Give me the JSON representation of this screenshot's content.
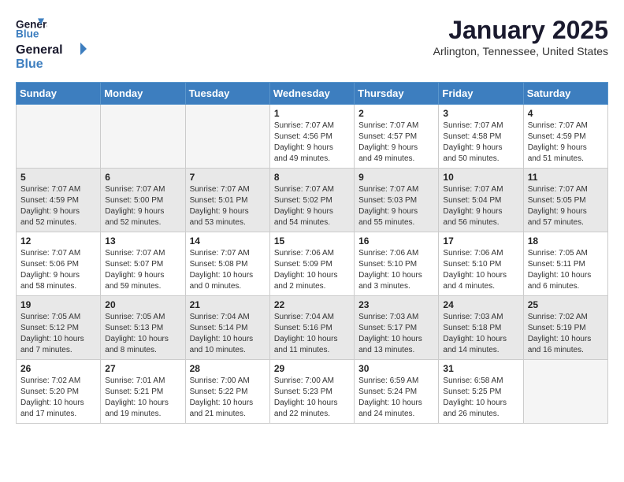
{
  "logo": {
    "general": "General",
    "blue": "Blue"
  },
  "title": "January 2025",
  "subtitle": "Arlington, Tennessee, United States",
  "days_of_week": [
    "Sunday",
    "Monday",
    "Tuesday",
    "Wednesday",
    "Thursday",
    "Friday",
    "Saturday"
  ],
  "weeks": [
    [
      {
        "day": "",
        "info": ""
      },
      {
        "day": "",
        "info": ""
      },
      {
        "day": "",
        "info": ""
      },
      {
        "day": "1",
        "info": "Sunrise: 7:07 AM\nSunset: 4:56 PM\nDaylight: 9 hours\nand 49 minutes."
      },
      {
        "day": "2",
        "info": "Sunrise: 7:07 AM\nSunset: 4:57 PM\nDaylight: 9 hours\nand 49 minutes."
      },
      {
        "day": "3",
        "info": "Sunrise: 7:07 AM\nSunset: 4:58 PM\nDaylight: 9 hours\nand 50 minutes."
      },
      {
        "day": "4",
        "info": "Sunrise: 7:07 AM\nSunset: 4:59 PM\nDaylight: 9 hours\nand 51 minutes."
      }
    ],
    [
      {
        "day": "5",
        "info": "Sunrise: 7:07 AM\nSunset: 4:59 PM\nDaylight: 9 hours\nand 52 minutes."
      },
      {
        "day": "6",
        "info": "Sunrise: 7:07 AM\nSunset: 5:00 PM\nDaylight: 9 hours\nand 52 minutes."
      },
      {
        "day": "7",
        "info": "Sunrise: 7:07 AM\nSunset: 5:01 PM\nDaylight: 9 hours\nand 53 minutes."
      },
      {
        "day": "8",
        "info": "Sunrise: 7:07 AM\nSunset: 5:02 PM\nDaylight: 9 hours\nand 54 minutes."
      },
      {
        "day": "9",
        "info": "Sunrise: 7:07 AM\nSunset: 5:03 PM\nDaylight: 9 hours\nand 55 minutes."
      },
      {
        "day": "10",
        "info": "Sunrise: 7:07 AM\nSunset: 5:04 PM\nDaylight: 9 hours\nand 56 minutes."
      },
      {
        "day": "11",
        "info": "Sunrise: 7:07 AM\nSunset: 5:05 PM\nDaylight: 9 hours\nand 57 minutes."
      }
    ],
    [
      {
        "day": "12",
        "info": "Sunrise: 7:07 AM\nSunset: 5:06 PM\nDaylight: 9 hours\nand 58 minutes."
      },
      {
        "day": "13",
        "info": "Sunrise: 7:07 AM\nSunset: 5:07 PM\nDaylight: 9 hours\nand 59 minutes."
      },
      {
        "day": "14",
        "info": "Sunrise: 7:07 AM\nSunset: 5:08 PM\nDaylight: 10 hours\nand 0 minutes."
      },
      {
        "day": "15",
        "info": "Sunrise: 7:06 AM\nSunset: 5:09 PM\nDaylight: 10 hours\nand 2 minutes."
      },
      {
        "day": "16",
        "info": "Sunrise: 7:06 AM\nSunset: 5:10 PM\nDaylight: 10 hours\nand 3 minutes."
      },
      {
        "day": "17",
        "info": "Sunrise: 7:06 AM\nSunset: 5:10 PM\nDaylight: 10 hours\nand 4 minutes."
      },
      {
        "day": "18",
        "info": "Sunrise: 7:05 AM\nSunset: 5:11 PM\nDaylight: 10 hours\nand 6 minutes."
      }
    ],
    [
      {
        "day": "19",
        "info": "Sunrise: 7:05 AM\nSunset: 5:12 PM\nDaylight: 10 hours\nand 7 minutes."
      },
      {
        "day": "20",
        "info": "Sunrise: 7:05 AM\nSunset: 5:13 PM\nDaylight: 10 hours\nand 8 minutes."
      },
      {
        "day": "21",
        "info": "Sunrise: 7:04 AM\nSunset: 5:14 PM\nDaylight: 10 hours\nand 10 minutes."
      },
      {
        "day": "22",
        "info": "Sunrise: 7:04 AM\nSunset: 5:16 PM\nDaylight: 10 hours\nand 11 minutes."
      },
      {
        "day": "23",
        "info": "Sunrise: 7:03 AM\nSunset: 5:17 PM\nDaylight: 10 hours\nand 13 minutes."
      },
      {
        "day": "24",
        "info": "Sunrise: 7:03 AM\nSunset: 5:18 PM\nDaylight: 10 hours\nand 14 minutes."
      },
      {
        "day": "25",
        "info": "Sunrise: 7:02 AM\nSunset: 5:19 PM\nDaylight: 10 hours\nand 16 minutes."
      }
    ],
    [
      {
        "day": "26",
        "info": "Sunrise: 7:02 AM\nSunset: 5:20 PM\nDaylight: 10 hours\nand 17 minutes."
      },
      {
        "day": "27",
        "info": "Sunrise: 7:01 AM\nSunset: 5:21 PM\nDaylight: 10 hours\nand 19 minutes."
      },
      {
        "day": "28",
        "info": "Sunrise: 7:00 AM\nSunset: 5:22 PM\nDaylight: 10 hours\nand 21 minutes."
      },
      {
        "day": "29",
        "info": "Sunrise: 7:00 AM\nSunset: 5:23 PM\nDaylight: 10 hours\nand 22 minutes."
      },
      {
        "day": "30",
        "info": "Sunrise: 6:59 AM\nSunset: 5:24 PM\nDaylight: 10 hours\nand 24 minutes."
      },
      {
        "day": "31",
        "info": "Sunrise: 6:58 AM\nSunset: 5:25 PM\nDaylight: 10 hours\nand 26 minutes."
      },
      {
        "day": "",
        "info": ""
      }
    ]
  ]
}
